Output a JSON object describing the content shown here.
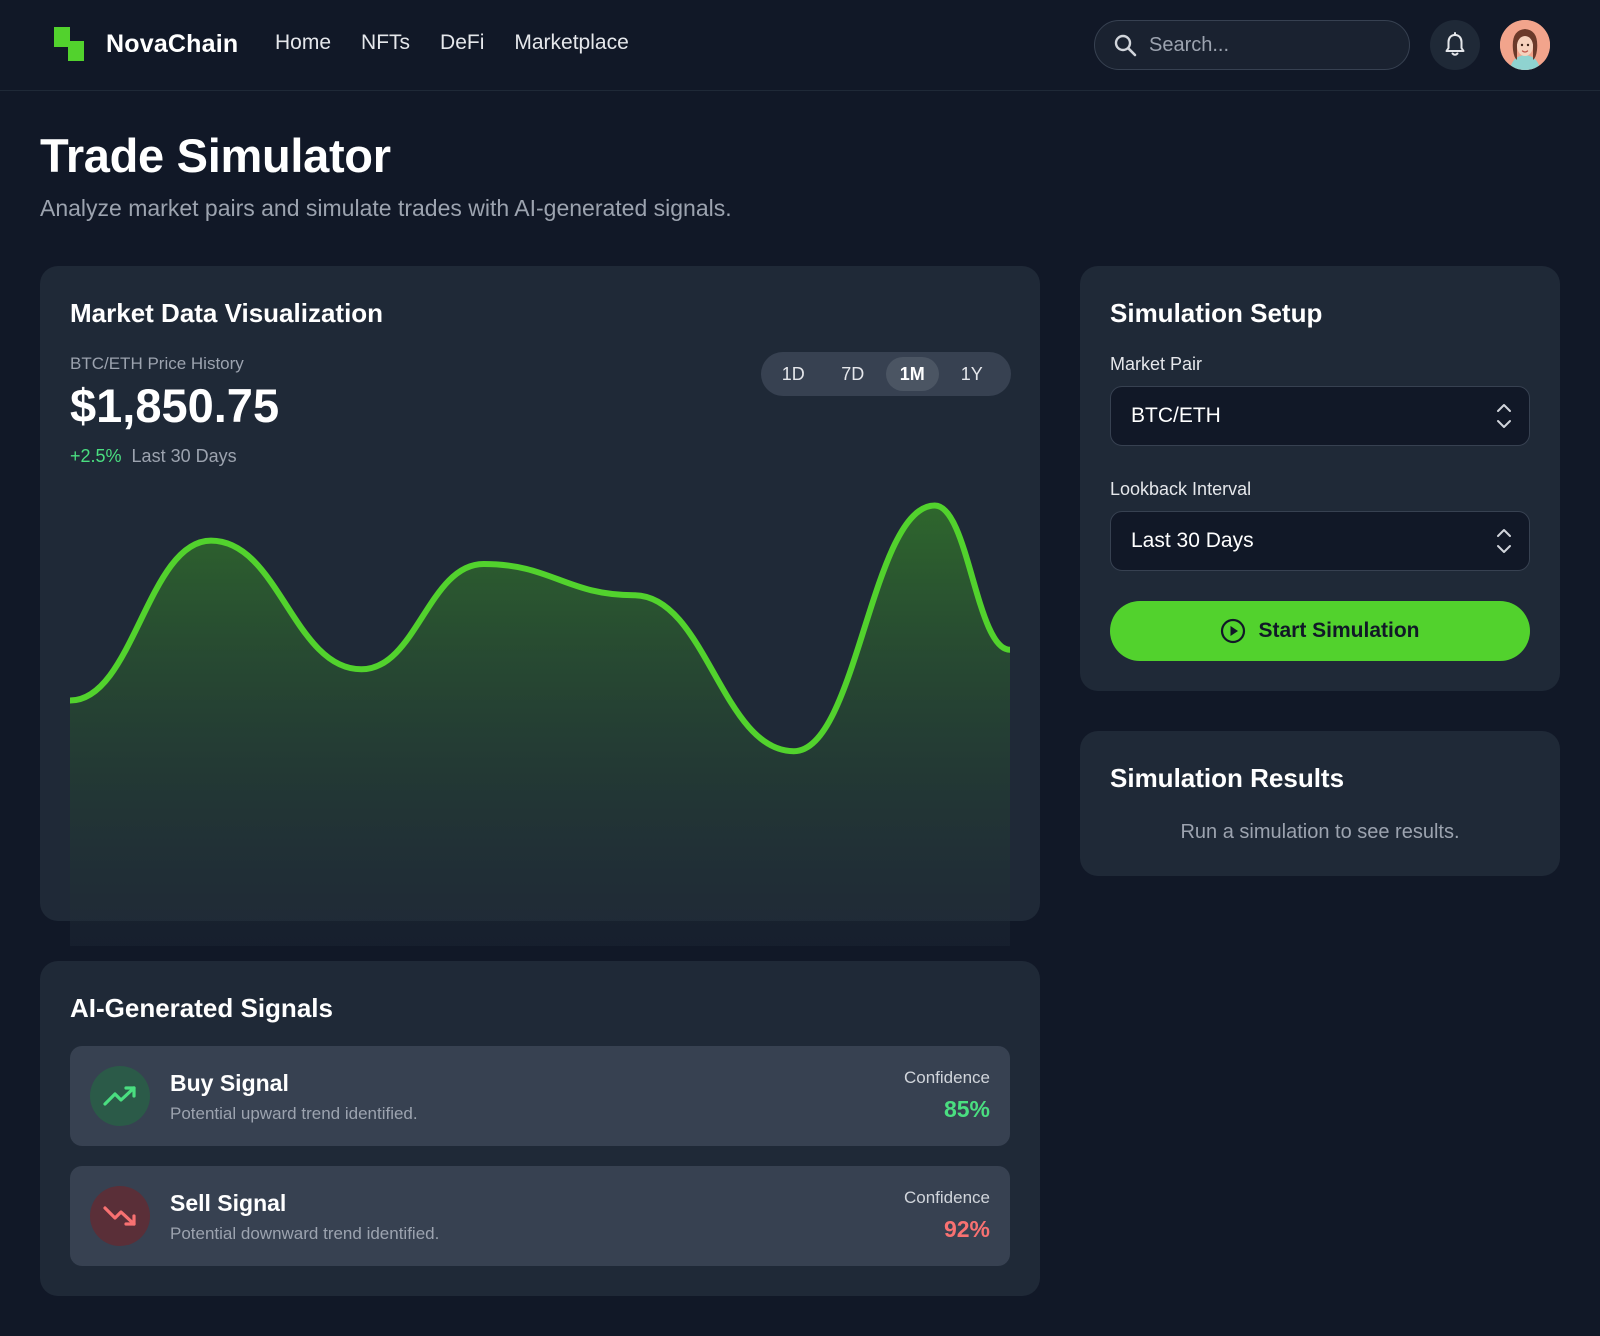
{
  "nav": {
    "brand": "NovaChain",
    "links": [
      "Home",
      "NFTs",
      "DeFi",
      "Marketplace"
    ],
    "search_placeholder": "Search..."
  },
  "header": {
    "title": "Trade Simulator",
    "subtitle": "Analyze market pairs and simulate trades with AI-generated signals."
  },
  "market": {
    "title": "Market Data Visualization",
    "pair_label": "BTC/ETH Price History",
    "price": "$1,850.75",
    "change": "+2.5%",
    "period": "Last 30 Days",
    "ranges": [
      "1D",
      "7D",
      "1M",
      "1Y"
    ],
    "active_range": "1M"
  },
  "chart_data": {
    "type": "area",
    "title": "",
    "xlabel": "",
    "ylabel": "",
    "grid": false,
    "x": [
      0,
      0.15,
      0.31,
      0.44,
      0.6,
      0.77,
      0.92,
      1.0
    ],
    "values": [
      0.45,
      0.86,
      0.53,
      0.8,
      0.72,
      0.32,
      0.95,
      0.58
    ],
    "ylim": [
      0,
      1
    ],
    "line_color": "#52d22d",
    "fill_color": "#2f5a2f"
  },
  "setup": {
    "title": "Simulation Setup",
    "pair_label": "Market Pair",
    "pair_value": "BTC/ETH",
    "interval_label": "Lookback Interval",
    "interval_value": "Last 30 Days",
    "start_label": "Start Simulation"
  },
  "results": {
    "title": "Simulation Results",
    "empty_text": "Run a simulation to see results."
  },
  "signals": {
    "title": "AI-Generated Signals",
    "items": [
      {
        "title": "Buy Signal",
        "desc": "Potential upward trend identified.",
        "conf_label": "Confidence",
        "conf": "85%",
        "color": "#4ade80",
        "icon": "trend-up-icon"
      },
      {
        "title": "Sell Signal",
        "desc": "Potential downward trend identified.",
        "conf_label": "Confidence",
        "conf": "92%",
        "color": "#f87171",
        "icon": "trend-down-icon"
      }
    ]
  },
  "colors": {
    "background": "#111827",
    "card": "#1f2937",
    "accent": "#52d22d"
  }
}
